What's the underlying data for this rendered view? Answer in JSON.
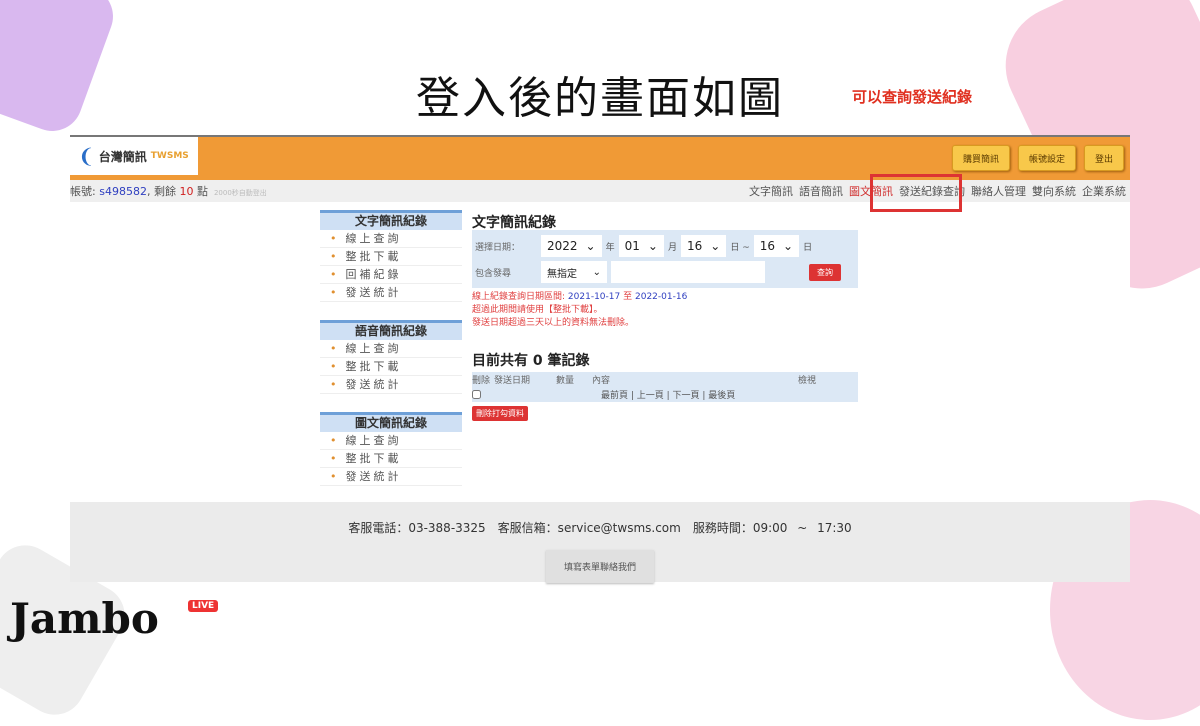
{
  "slide": {
    "title": "登入後的畫面如圖",
    "annotation": "可以查詢發送紀錄",
    "brand": "Jambo",
    "brand_badge": "LIVE"
  },
  "header": {
    "logo_text": "台灣簡訊",
    "logo_en": "TWSMS",
    "buttons": [
      "購買簡訊",
      "帳號設定",
      "登出"
    ]
  },
  "account": {
    "label": "帳號:",
    "id": "s498582",
    "remain_label": ", 剩餘",
    "points": "10",
    "unit": "點",
    "hint": "2000秒自動登出"
  },
  "nav": [
    "文字簡訊",
    "語音簡訊",
    "圖文簡訊",
    "發送紀錄查詢",
    "聯絡人管理",
    "雙向系統",
    "企業系統"
  ],
  "sidebar": [
    {
      "title": "文字簡訊紀錄",
      "items": [
        "線上查詢",
        "整批下載",
        "回補紀錄",
        "發送統計"
      ]
    },
    {
      "title": "語音簡訊紀錄",
      "items": [
        "線上查詢",
        "整批下載",
        "發送統計"
      ]
    },
    {
      "title": "圖文簡訊紀錄",
      "items": [
        "線上查詢",
        "整批下載",
        "發送統計"
      ]
    }
  ],
  "main": {
    "title": "文字簡訊紀錄",
    "date_label": "選擇日期：",
    "year": "2022",
    "year_u": "年",
    "month": "01",
    "month_u": "月",
    "day_from": "16",
    "day_u1": "日 ~",
    "day_to": "16",
    "day_u2": "日",
    "filter_label": "包含發尋",
    "filter_value": "無指定",
    "query": "查詢",
    "msg1": "線上紀錄查詢日期區間:",
    "d1": "2021-10-17",
    "to": "至",
    "d2": "2022-01-16",
    "msg2": "超過此期間請使用【整批下載】。",
    "msg3": "發送日期超過三天以上的資料無法刪除。",
    "count": "目前共有 0 筆記錄",
    "cols": [
      "刪除",
      "發送日期",
      "數量",
      "內容",
      "檢視"
    ],
    "pager": "最前頁 | 上一頁 | 下一頁 | 最後頁",
    "delete_btn": "刪除打勾資料"
  },
  "footer": {
    "info": "客服電話：03-388-3325　客服信箱：service@twsms.com　服務時間：09:00 ~ 17:30",
    "form_btn": "填寫表單聯絡我們"
  }
}
